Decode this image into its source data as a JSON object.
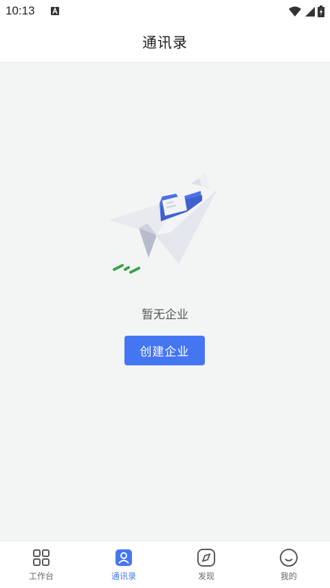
{
  "status_bar": {
    "time": "10:13"
  },
  "header": {
    "title": "通讯录"
  },
  "empty_state": {
    "message": "暂无企业",
    "button_label": "创建企业"
  },
  "tabbar": {
    "active": "通讯录",
    "items": [
      {
        "label": "工作台",
        "icon": "grid-icon"
      },
      {
        "label": "通讯录",
        "icon": "contact-icon"
      },
      {
        "label": "发现",
        "icon": "compass-icon"
      },
      {
        "label": "我的",
        "icon": "smile-icon"
      }
    ]
  },
  "colors": {
    "accent": "#4576f2",
    "background": "#f3f4f4",
    "green": "#3aa14a"
  }
}
